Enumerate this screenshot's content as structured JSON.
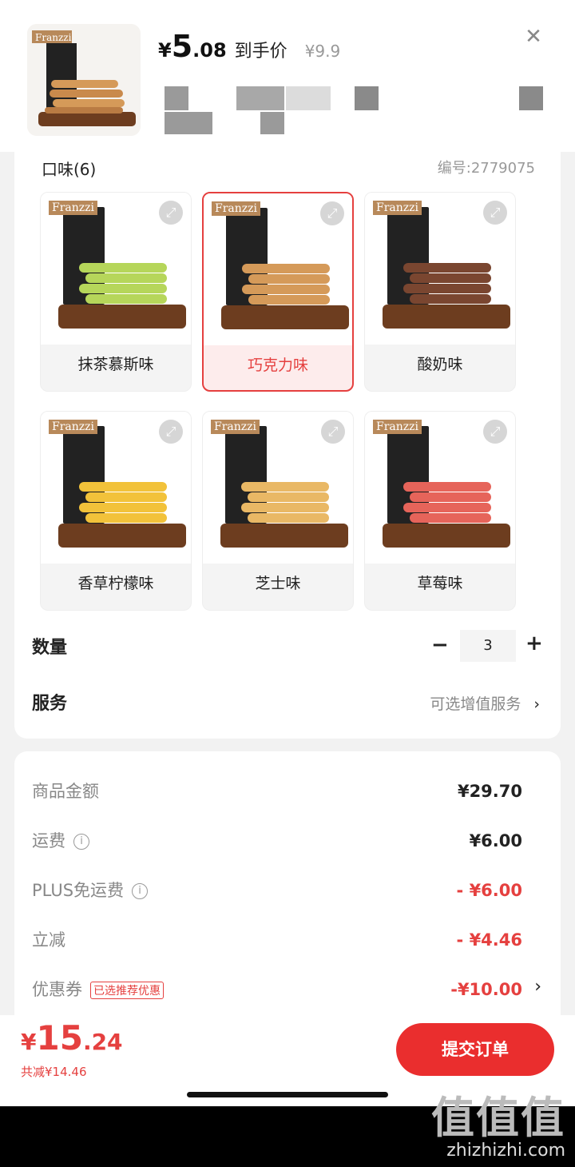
{
  "header": {
    "price_symbol": "¥",
    "price_integer": "5",
    "price_decimal": ".08",
    "price_label": "到手价",
    "original_price": "¥9.9",
    "close_icon": "close-icon"
  },
  "flavor": {
    "title": "口味(6)",
    "code": "编号:2779075",
    "brand": "Franzzi",
    "items": [
      {
        "label": "抹茶慕斯味",
        "selected": false,
        "color": "#b6d65a"
      },
      {
        "label": "巧克力味",
        "selected": true,
        "color": "#d59a59"
      },
      {
        "label": "酸奶味",
        "selected": false,
        "color": "#7a4630"
      },
      {
        "label": "香草柠檬味",
        "selected": false,
        "color": "#f2c23a"
      },
      {
        "label": "芝士味",
        "selected": false,
        "color": "#e9b865"
      },
      {
        "label": "草莓味",
        "selected": false,
        "color": "#e6645a"
      }
    ]
  },
  "quantity": {
    "label": "数量",
    "minus": "−",
    "value": "3",
    "plus": "+"
  },
  "service": {
    "label": "服务",
    "value": "可选增值服务",
    "chevron": "›"
  },
  "fees": {
    "goods_label": "商品金额",
    "goods_value": "¥29.70",
    "shipping_label": "运费",
    "shipping_value": "¥6.00",
    "plus_label": "PLUS免运费",
    "plus_value": "- ¥6.00",
    "discount_label": "立减",
    "discount_value": "- ¥4.46",
    "coupon_label": "优惠券",
    "coupon_tag": "已选推荐优惠",
    "coupon_value": "-¥10.00",
    "info_glyph": "i",
    "chevron": "›"
  },
  "footer": {
    "total_symbol": "¥",
    "total_integer": "15",
    "total_decimal": ".24",
    "saved": "共减¥14.46",
    "submit_label": "提交订单"
  },
  "watermark": {
    "big": "值值值",
    "small": "zhizhizhi.com"
  },
  "colors": {
    "accent": "#e5403f",
    "button": "#ea2e2e"
  }
}
